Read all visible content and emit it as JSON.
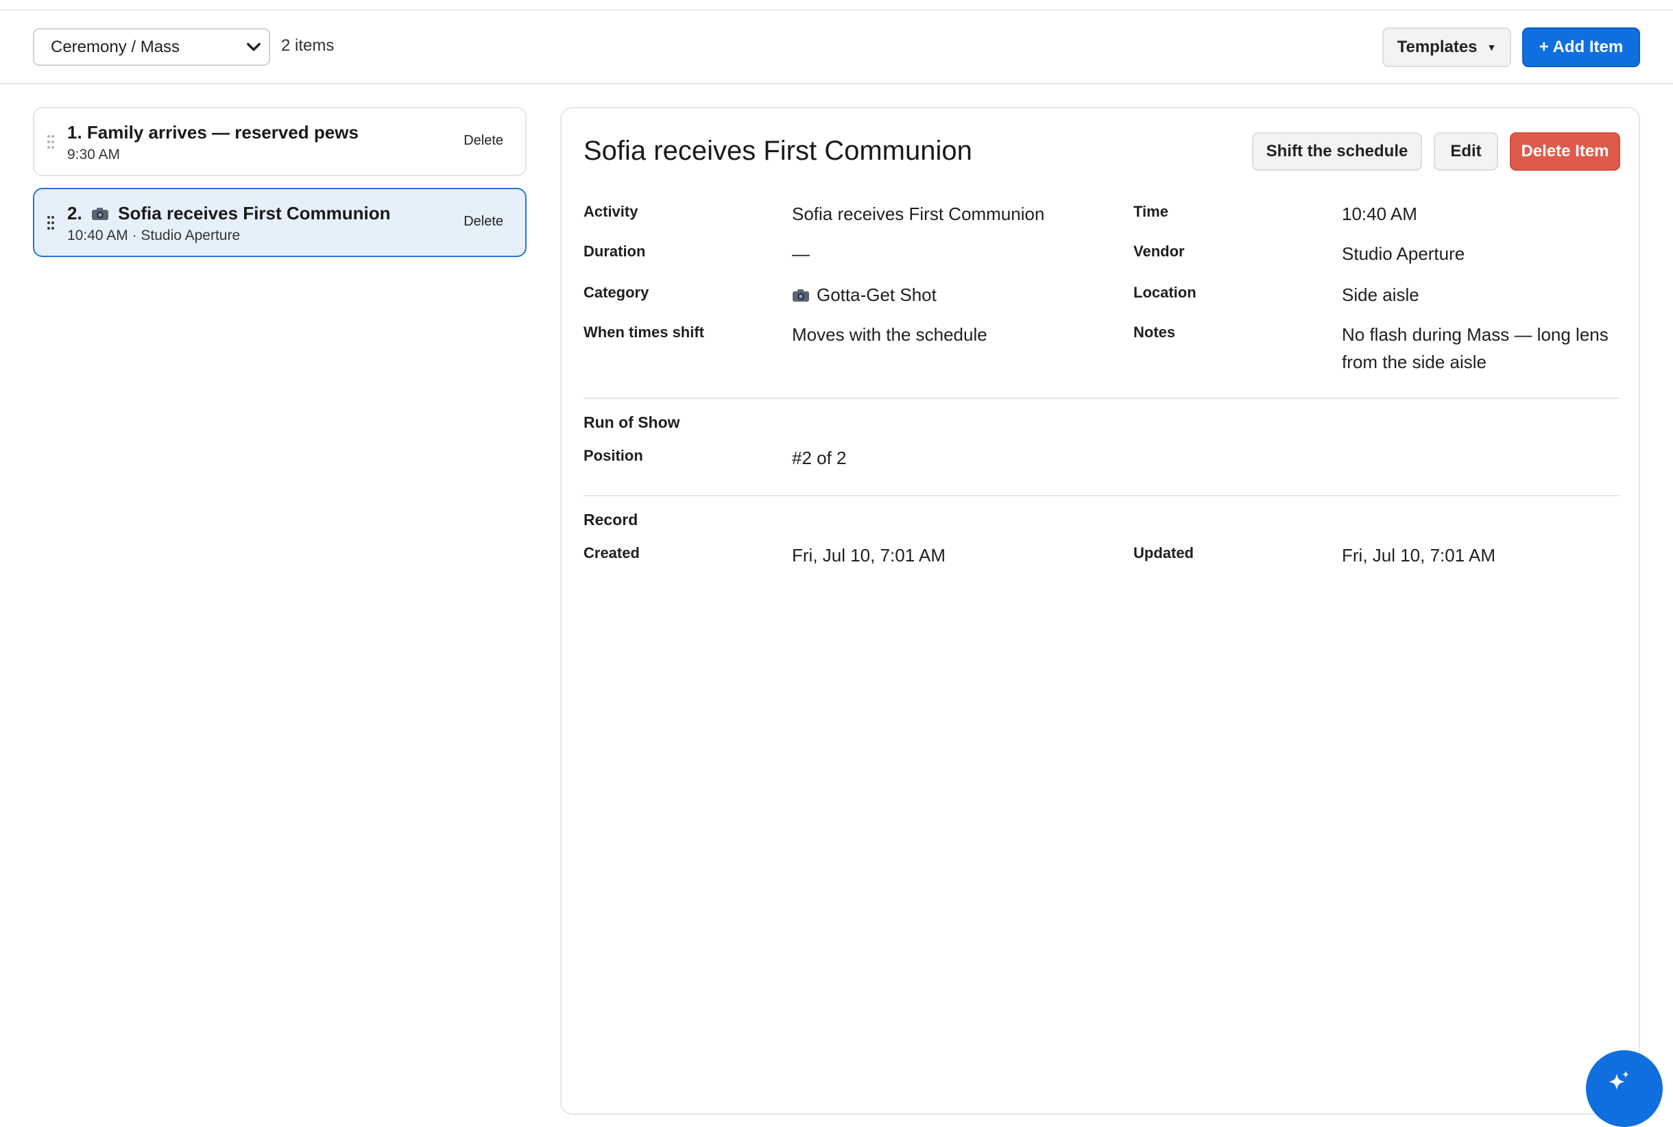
{
  "toolbar": {
    "section_select": "Ceremony / Mass",
    "item_count": "2 items",
    "templates_label": "Templates",
    "add_item_label": "+ Add Item"
  },
  "items": [
    {
      "title": "1. Family arrives — reserved pews",
      "number": "",
      "name": "",
      "subtitle": "9:30 AM",
      "delete_label": "Delete"
    },
    {
      "title": "",
      "number": "2.",
      "name": "Sofia receives First Communion",
      "subtitle": "10:40 AM · Studio Aperture",
      "delete_label": "Delete"
    }
  ],
  "detail": {
    "title": "Sofia receives First Communion",
    "shift_label": "Shift the schedule",
    "edit_label": "Edit",
    "delete_label": "Delete Item",
    "fields": {
      "activity_label": "Activity",
      "activity_value": "Sofia receives First Communion",
      "time_label": "Time",
      "time_value": "10:40 AM",
      "duration_label": "Duration",
      "duration_value": "—",
      "vendor_label": "Vendor",
      "vendor_value": "Studio Aperture",
      "category_label": "Category",
      "category_value": "Gotta-Get Shot",
      "location_label": "Location",
      "location_value": "Side aisle",
      "shift_label": "When times shift",
      "shift_value": "Moves with the schedule",
      "notes_label": "Notes",
      "notes_value": "No flash during Mass — long lens from the side aisle"
    },
    "run_of_show": {
      "heading": "Run of Show",
      "position_label": "Position",
      "position_value": "#2 of 2"
    },
    "record": {
      "heading": "Record",
      "created_label": "Created",
      "created_value": "Fri, Jul 10, 7:01 AM",
      "updated_label": "Updated",
      "updated_value": "Fri, Jul 10, 7:01 AM"
    }
  },
  "colors": {
    "accent": "#0f6fde",
    "danger": "#de5a4b",
    "selected_bg": "#e6f0fb",
    "selected_border": "#2277d2"
  },
  "icons": {
    "select_chevron": "chevron-down-icon",
    "drag": "drag-handle-icon",
    "category": "camera-icon",
    "fab": "sparkle-icon"
  }
}
